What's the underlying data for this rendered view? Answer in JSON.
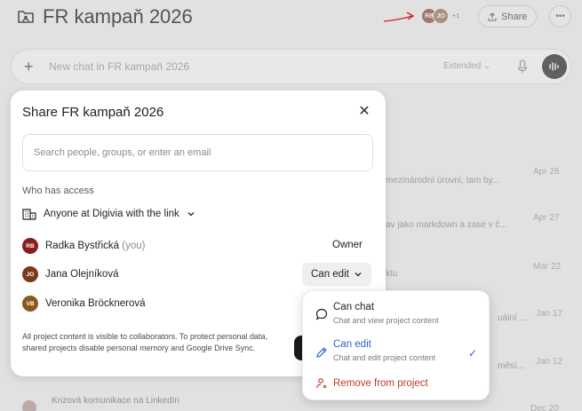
{
  "project": {
    "title": "FR kampaň 2026",
    "icon": "folder-people-icon"
  },
  "header": {
    "avatars": [
      "RB",
      "JO"
    ],
    "more_count": "+1",
    "share_label": "Share",
    "more_icon": "ellipsis-icon"
  },
  "chat_bar": {
    "placeholder": "New chat in FR kampaň 2026",
    "mode": "Extended"
  },
  "background_rows": [
    {
      "snippet": "mezinárodní úrovni, tam by...",
      "date": "Apr 28"
    },
    {
      "snippet": "av jako markdown a zase v č...",
      "date": "Apr 27"
    },
    {
      "snippet": "ktu",
      "date": "Mar 22"
    },
    {
      "snippet": "uální ...",
      "date": "Jan 17"
    },
    {
      "snippet": "měsí...",
      "date": "Jan 12"
    },
    {
      "snippet": "",
      "date": "Dec 20"
    }
  ],
  "bottom_chat_title": "Krizová komunikace na LinkedIn",
  "modal": {
    "title": "Share FR kampaň 2026",
    "search_placeholder": "Search people, groups, or enter an email",
    "who_has_access": "Who has access",
    "anyone_label": "Anyone at Digivia with the link",
    "members": [
      {
        "initials": "RB",
        "name": "Radka Bystřická",
        "suffix": "(you)",
        "role": "Owner"
      },
      {
        "initials": "JO",
        "name": "Jana Olejníková",
        "suffix": "",
        "role": "Can edit"
      },
      {
        "initials": "VB",
        "name": "Veronika Bröcknerová",
        "suffix": "",
        "role": ""
      }
    ],
    "footer_text": "All project content is visible to collaborators. To protect personal data, shared projects disable personal memory and Google Drive Sync."
  },
  "permission_menu": {
    "items": [
      {
        "label": "Can chat",
        "description": "Chat and view project content",
        "icon": "chat-bubble-icon",
        "selected": false
      },
      {
        "label": "Can edit",
        "description": "Chat and edit project content",
        "icon": "pencil-icon",
        "selected": true
      }
    ],
    "remove_label": "Remove from project",
    "remove_icon": "remove-person-icon"
  },
  "colors": {
    "accent_blue": "#2b63c7",
    "danger_red": "#c03a2b",
    "annotation_red": "#e02020"
  }
}
